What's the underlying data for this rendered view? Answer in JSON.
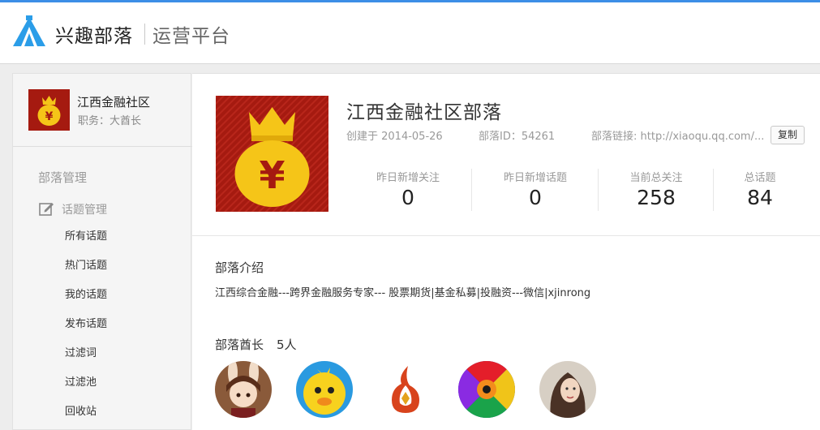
{
  "header": {
    "brand": "兴趣部落",
    "platform": "运营平台",
    "logo_icon": "tent-icon"
  },
  "sidebar": {
    "tribe_name": "江西金融社区",
    "role": "职务：大酋长",
    "section": "部落管理",
    "group_label": "话题管理",
    "group_icon": "edit-icon",
    "items": [
      {
        "label": "所有话题"
      },
      {
        "label": "热门话题"
      },
      {
        "label": "我的话题"
      },
      {
        "label": "发布话题"
      },
      {
        "label": "过滤词"
      },
      {
        "label": "过滤池"
      },
      {
        "label": "回收站"
      }
    ]
  },
  "tribe": {
    "title": "江西金融社区部落",
    "created": "创建于 2014-05-26",
    "tribe_id": "部落ID：54261",
    "link": "部落链接: http://xiaoqu.qq.com/...",
    "copy_label": "复制",
    "avatar_icon": "money-bag-icon"
  },
  "stats": [
    {
      "label": "昨日新增关注",
      "value": "0"
    },
    {
      "label": "昨日新增话题",
      "value": "0"
    },
    {
      "label": "当前总关注",
      "value": "258"
    },
    {
      "label": "总话题",
      "value": "84"
    }
  ],
  "intro": {
    "title": "部落介绍",
    "text": "江西综合金融---跨界金融服务专家--- 股票期货|基金私募|投融资---微信|xjinrong"
  },
  "chiefs": {
    "title": "部落酋长",
    "count": "5人",
    "avatars": [
      "anime-girl-avatar",
      "chick-avatar",
      "logo-avatar",
      "rainbow-swirl-avatar",
      "woman-avatar"
    ]
  },
  "colors": {
    "accent": "#3c8ee6",
    "avatar_red": "#a51a10",
    "bag_yellow": "#f5c518"
  }
}
